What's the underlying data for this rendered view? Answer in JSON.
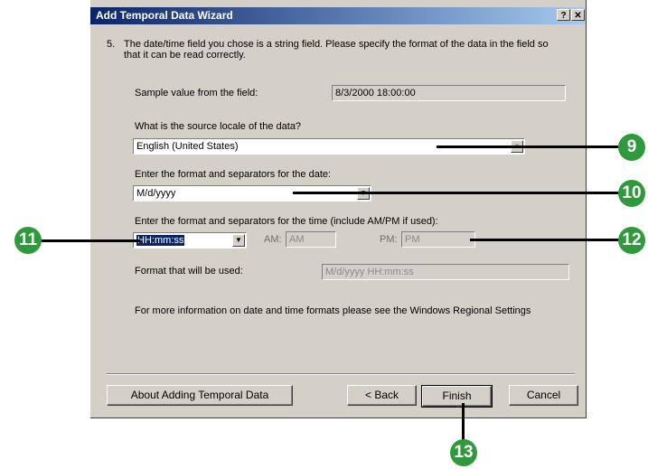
{
  "dialog": {
    "title": "Add Temporal Data Wizard",
    "help_glyph": "?",
    "close_glyph": "✕",
    "step_number": "5.",
    "instruction": "The date/time field you chose is a string field.  Please specify the format of the data in the field so that it can be read correctly.",
    "sample_label": "Sample value from the field:",
    "sample_value": "8/3/2000 18:00:00",
    "locale_label": "What is the source locale of the data?",
    "locale_value": "English (United States)",
    "date_label": "Enter the format and separators for the date:",
    "date_value": "M/d/yyyy",
    "time_label": "Enter the format and separators for the time (include AM/PM if used):",
    "time_value": "HH:mm:ss",
    "am_label": "AM:",
    "am_value": "AM",
    "pm_label": "PM:",
    "pm_value": "PM",
    "format_label": "Format that will be used:",
    "format_value": "M/d/yyyy HH:mm:ss",
    "info_text": "For more information on date and time formats please see the Windows Regional Settings"
  },
  "buttons": {
    "about": "About Adding Temporal Data",
    "back": "< Back",
    "finish": "Finish",
    "cancel": "Cancel"
  },
  "callouts": {
    "c9": "9",
    "c10": "10",
    "c11": "11",
    "c12": "12",
    "c13": "13"
  },
  "colors": {
    "callout": "#2f9a3b",
    "titlebar_start": "#0a246a",
    "titlebar_end": "#a6caf0",
    "dialog_face": "#d4d0c8"
  },
  "icons": {
    "dropdown": "chevron-down-icon"
  }
}
